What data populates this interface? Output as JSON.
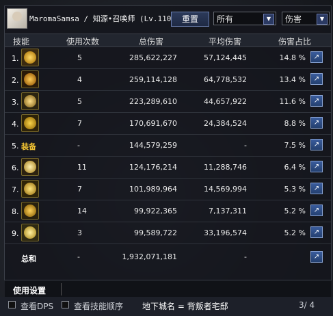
{
  "header": {
    "title": "MaromaSamsa / 知源•召唤师 (Lv.110)",
    "reset_label": "重置",
    "filter_value": "所有",
    "metric_value": "伤害"
  },
  "columns": [
    "技能",
    "使用次数",
    "总伤害",
    "平均伤害",
    "伤害占比"
  ],
  "rows": [
    {
      "rank": "1.",
      "icon": "skill-icon-1",
      "uses": "5",
      "total": "285,622,227",
      "avg": "57,124,445",
      "pct": "14.8 %"
    },
    {
      "rank": "2.",
      "icon": "skill-icon-2",
      "uses": "4",
      "total": "259,114,128",
      "avg": "64,778,532",
      "pct": "13.4 %"
    },
    {
      "rank": "3.",
      "icon": "skill-icon-3",
      "uses": "5",
      "total": "223,289,610",
      "avg": "44,657,922",
      "pct": "11.6 %"
    },
    {
      "rank": "4.",
      "icon": "skill-icon-4",
      "uses": "7",
      "total": "170,691,670",
      "avg": "24,384,524",
      "pct": "8.8 %"
    },
    {
      "rank": "5.",
      "icon": "equip-label",
      "equip_label": "装备",
      "uses": "-",
      "total": "144,579,259",
      "avg": "-",
      "pct": "7.5 %"
    },
    {
      "rank": "6.",
      "icon": "skill-icon-6",
      "uses": "11",
      "total": "124,176,214",
      "avg": "11,288,746",
      "pct": "6.4 %"
    },
    {
      "rank": "7.",
      "icon": "skill-icon-7",
      "uses": "7",
      "total": "101,989,964",
      "avg": "14,569,994",
      "pct": "5.3 %"
    },
    {
      "rank": "8.",
      "icon": "skill-icon-8",
      "uses": "14",
      "total": "99,922,365",
      "avg": "7,137,311",
      "pct": "5.2 %"
    },
    {
      "rank": "9.",
      "icon": "skill-icon-9",
      "uses": "3",
      "total": "99,589,722",
      "avg": "33,196,574",
      "pct": "5.2 %"
    }
  ],
  "summary": {
    "label": "总和",
    "uses": "-",
    "total": "1,932,071,181",
    "avg": "-"
  },
  "footer": {
    "usage_settings": "使用设置"
  },
  "bottombar": {
    "show_dps": "查看DPS",
    "show_order": "查看技能顺序",
    "location": "地下城名 = 背叛者宅邸",
    "page": "3/ 4"
  },
  "colors": {
    "accent": "#f1c232",
    "share_button": "#2f4f8a"
  }
}
